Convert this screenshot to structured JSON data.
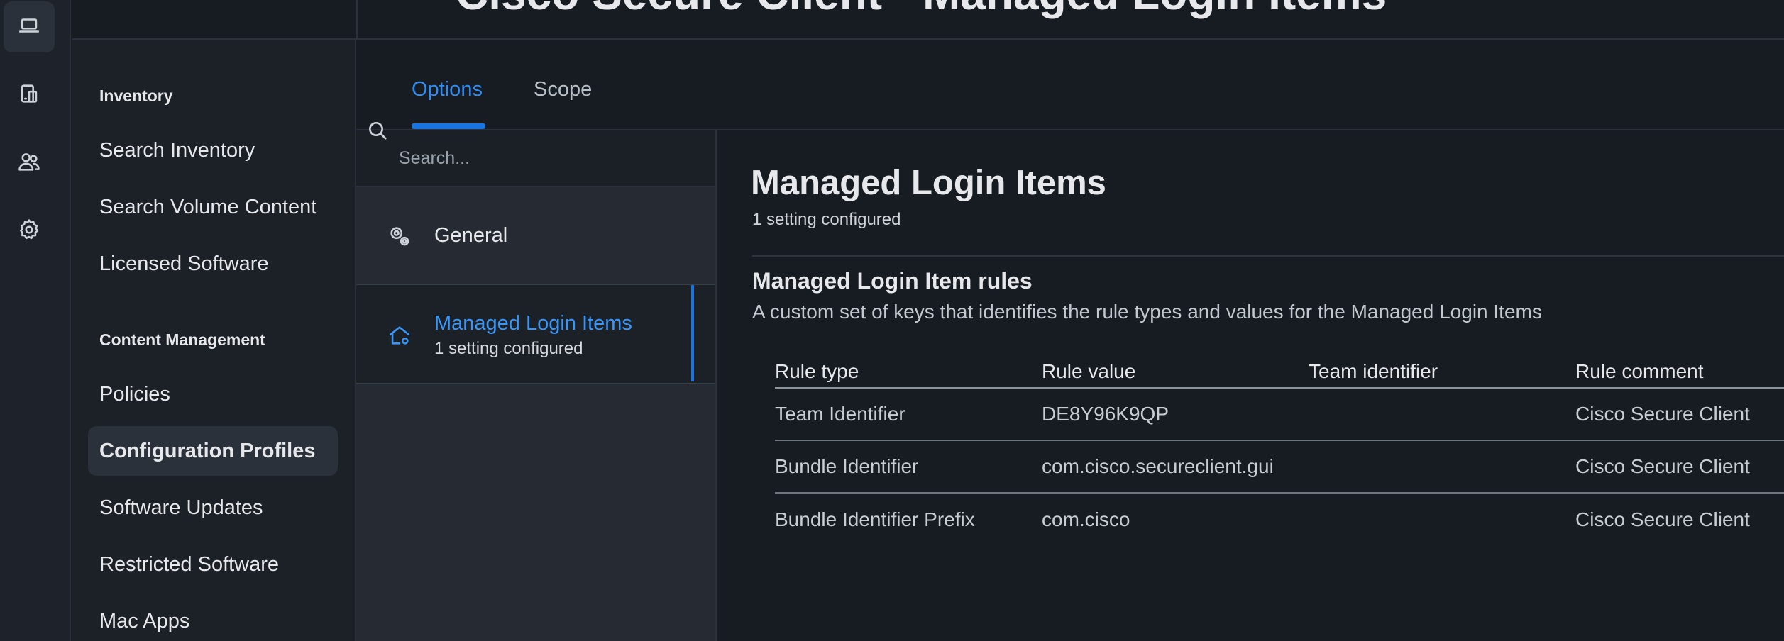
{
  "app": {
    "title": "Cisco Secure Client - Managed Login Items"
  },
  "rail": {
    "items": [
      {
        "icon": "laptop-icon",
        "active": true
      },
      {
        "icon": "devices-icon",
        "active": false
      },
      {
        "icon": "users-icon",
        "active": false
      },
      {
        "icon": "gear-icon",
        "active": false
      }
    ]
  },
  "sidebar": {
    "sections": [
      {
        "label": "Inventory",
        "items": [
          "Search Inventory",
          "Search Volume Content",
          "Licensed Software"
        ]
      },
      {
        "label": "Content Management",
        "items": [
          "Policies",
          "Configuration Profiles",
          "Software Updates",
          "Restricted Software",
          "Mac Apps"
        ]
      }
    ],
    "active_item": "Configuration Profiles"
  },
  "tabs": {
    "options": "Options",
    "scope": "Scope",
    "active": "Options"
  },
  "search": {
    "placeholder": "Search..."
  },
  "settings_list": [
    {
      "name": "General",
      "icon": "gears-icon",
      "subtitle": ""
    },
    {
      "name": "Managed Login Items",
      "icon": "home-gear-icon",
      "subtitle": "1 setting configured",
      "selected": true
    }
  ],
  "main": {
    "title": "Managed Login Items",
    "subtitle": "1 setting configured",
    "section_title": "Managed Login Item rules",
    "section_desc": "A custom set of keys that identifies the rule types and values for the Managed Login Items",
    "table": {
      "columns": [
        "Rule type",
        "Rule value",
        "Team identifier",
        "Rule comment"
      ],
      "rows": [
        [
          "Team Identifier",
          "DE8Y96K9QP",
          "",
          "Cisco Secure Client"
        ],
        [
          "Bundle Identifier",
          "com.cisco.secureclient.gui",
          "",
          "Cisco Secure Client"
        ],
        [
          "Bundle Identifier Prefix",
          "com.cisco",
          "",
          "Cisco Secure Client"
        ]
      ]
    }
  },
  "colors": {
    "accent": "#1a74e0",
    "background": "#171b22",
    "panel": "#262b33"
  }
}
